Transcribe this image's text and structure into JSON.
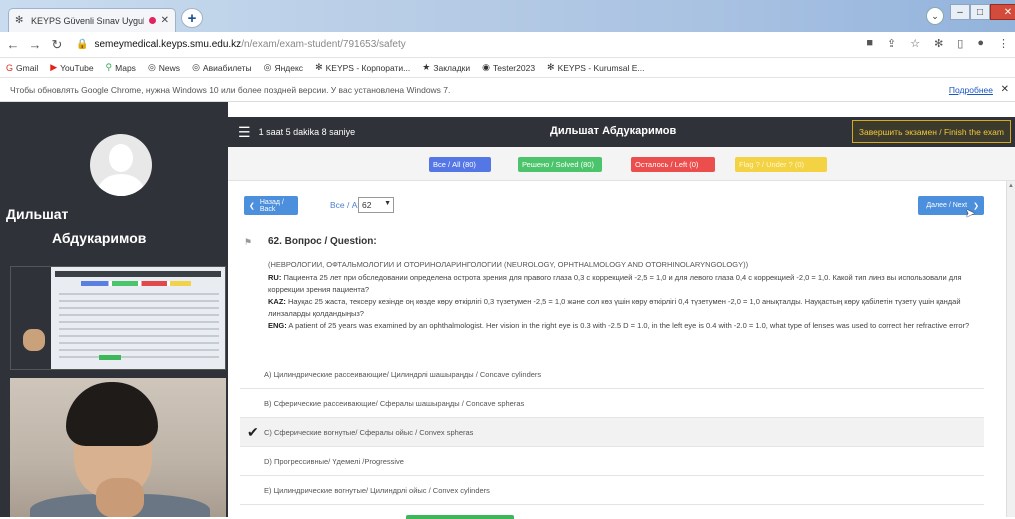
{
  "browser": {
    "tab_title": "KEYPS Güvenli Sınav Uygula",
    "new_tab": "+",
    "url_host": "semeymedical.keyps.smu.edu.kz",
    "url_path": "/n/exam/exam-student/791653/safety",
    "bookmarks": [
      "Gmail",
      "YouTube",
      "Maps",
      "News",
      "Авиабилеты",
      "Яндекс",
      "KEYPS - Корпорати...",
      "Закладки",
      "Tester2023",
      "KEYPS - Kurumsal E..."
    ],
    "infobar_text": "Чтобы обновлять Google Chrome, нужна Windows 10 или более поздней версии. У вас установлена Windows 7.",
    "infobar_link": "Подробнее"
  },
  "sidebar": {
    "first_name": "Дильшат",
    "last_name": "Абдукаримов"
  },
  "topbar": {
    "timer": "1 saat 5 dakika 8 saniye",
    "student_name": "Дильшат Абдукаримов",
    "finish_label": "Завершить экзамен / Finish the exam"
  },
  "filters": {
    "all": "Все / All (80)",
    "solved": "Решено / Solved (80)",
    "left": "Осталось / Left (0)",
    "flagged": "Flag ? / Under ? (0)"
  },
  "nav": {
    "back": "Назад / Back",
    "all_label": "Все / All",
    "question_number": "62",
    "next": "Далее / Next"
  },
  "question": {
    "title": "62. Вопрос / Question:",
    "subject": "(НЕВРОЛОГИИ, ОФТАЛЬМОЛОГИИ И ОТОРИНОЛАРИНГОЛОГИИ (NEUROLOGY, OPHTHALMOLOGY AND OTORHINOLARYNGOLOGY))",
    "ru_label": "RU:",
    "ru_text": "Пациента 25 лет при обследовании определена острота зрения для правого глаза 0,3 с коррекцией -2,5 = 1,0 и для левого глаза 0,4 с коррекцией -2,0 = 1,0. Какой тип линз вы использовали для коррекции зрения пациента?",
    "kaz_label": "KAZ:",
    "kaz_text": "Науқас 25 жаста, тексеру кезінде оң көзде көру өткірлігі 0,3 түзетумен -2,5 = 1,0 және сол көз үшін көру өткірлігі 0,4 түзетумен -2,0 = 1,0 анықталды. Науқастың көру қабілетін түзету үшін қандай линзаларды қолдандыңыз?",
    "eng_label": "ENG:",
    "eng_text": "A patient of 25 years was examined by an ophthalmologist. Her vision in the right eye is 0.3 with -2.5 D = 1.0, in the left eye is 0.4 with -2.0 = 1.0, what type of lenses was used to correct her refractive error?"
  },
  "options": [
    {
      "label": "A) Цилиндрические рассеивающие/ Цилиндрлі шашыраңды / Concave cylinders",
      "selected": false
    },
    {
      "label": "B) Сферические рассеивающие/ Сфералы шашыраңды / Concave spheras",
      "selected": false
    },
    {
      "label": "C) Сферические вогнутые/ Сфералы ойыс / Convex spheras",
      "selected": true
    },
    {
      "label": "D) Прогрессивные/ Үдемелі /Progressive",
      "selected": false
    },
    {
      "label": "E) Цилиндрические вогнутые/ Цилиндрлі ойыс / Convex cylinders",
      "selected": false
    }
  ]
}
